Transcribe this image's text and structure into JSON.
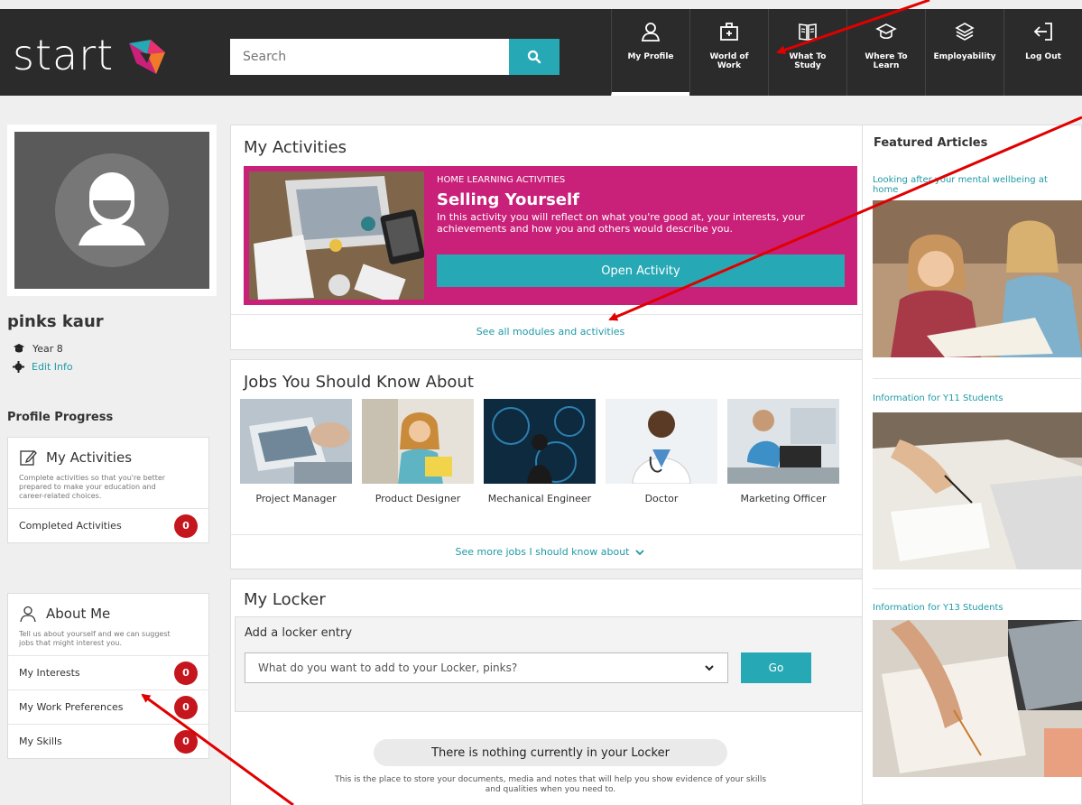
{
  "header": {
    "logo_text": "start",
    "search_placeholder": "Search",
    "nav": [
      {
        "label": "My Profile",
        "icon": "person-icon"
      },
      {
        "label": "World of Work",
        "icon": "briefcase-icon"
      },
      {
        "label": "What To Study",
        "icon": "book-icon"
      },
      {
        "label": "Where To Learn",
        "icon": "graduation-cap-icon"
      },
      {
        "label": "Employability",
        "icon": "layers-icon"
      },
      {
        "label": "Log Out",
        "icon": "logout-icon"
      }
    ]
  },
  "profile": {
    "name": "pinks kaur",
    "year": "Year 8",
    "edit_label": "Edit Info",
    "progress_heading": "Profile Progress"
  },
  "activities_card": {
    "title": "My Activities",
    "description": "Complete activities so that you're better prepared to make your education and career-related choices.",
    "rows": [
      {
        "label": "Completed Activities",
        "count": "0"
      }
    ]
  },
  "about_card": {
    "title": "About Me",
    "description": "Tell us about yourself and we can suggest jobs that might interest you.",
    "rows": [
      {
        "label": "My Interests",
        "count": "0"
      },
      {
        "label": "My Work Preferences",
        "count": "0"
      },
      {
        "label": "My Skills",
        "count": "0"
      }
    ]
  },
  "my_activities": {
    "title": "My Activities",
    "kicker": "HOME LEARNING ACTIVITIES",
    "activity_title": "Selling Yourself",
    "activity_desc": "In this activity you will reflect on what you're good at, your interests, your achievements and how you and others would describe you.",
    "open_label": "Open Activity",
    "see_all": "See all modules and activities"
  },
  "jobs": {
    "title": "Jobs You Should Know About",
    "items": [
      "Project Manager",
      "Product Designer",
      "Mechanical Engineer",
      "Doctor",
      "Marketing Officer"
    ],
    "see_more": "See more jobs I should know about"
  },
  "locker": {
    "title": "My Locker",
    "add_label": "Add a locker entry",
    "select_value": "What do you want to add to your Locker, pinks?",
    "go_label": "Go",
    "empty_title": "There is nothing currently in your Locker",
    "empty_desc": "This is the place to store your documents, media and notes that will help you show evidence of your skills and qualities when you need to."
  },
  "featured": {
    "title": "Featured Articles",
    "articles": [
      {
        "title": "Looking after your mental wellbeing at home"
      },
      {
        "title": "Information for Y11 Students"
      },
      {
        "title": "Information for Y13 Students"
      }
    ]
  },
  "colors": {
    "accent": "#27a9b5",
    "brand_pink": "#c92079",
    "badge_red": "#c4161c",
    "topbar": "#2b2b2b",
    "annotation_arrow": "#e00000"
  }
}
